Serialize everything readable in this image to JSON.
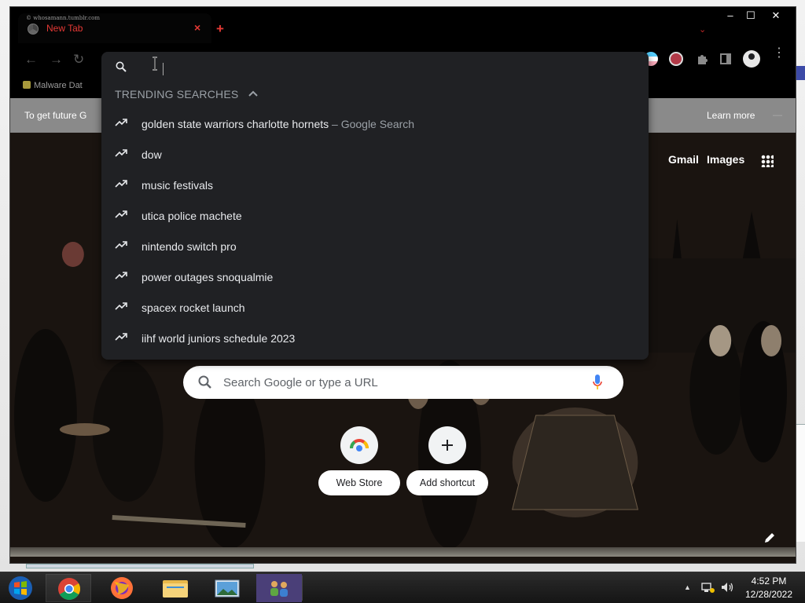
{
  "window": {
    "tab_title": "New Tab",
    "tab_watermark": "© whosamann.tumblr.com",
    "new_tab_symbol": "+",
    "tab_close_symbol": "×",
    "controls": {
      "minimize": "–",
      "maximize": "☐",
      "close": "✕"
    }
  },
  "toolbar": {
    "back_icon": "←",
    "forward_icon": "→",
    "reload_icon": "↻",
    "extensions": [
      "flag-icon",
      "avatar-extension-icon",
      "puzzle-icon",
      "sidepanel-icon"
    ],
    "menu_icon": "⋮"
  },
  "bookmarks": [
    {
      "label": "Malware Dat"
    }
  ],
  "infobar": {
    "message": "To get future G",
    "learn_more": "Learn more"
  },
  "omnibox": {
    "input_value": "",
    "section_title": "TRENDING SEARCHES",
    "suggestions": [
      {
        "query": "golden state warriors charlotte hornets",
        "suffix": " – Google Search"
      },
      {
        "query": "dow",
        "suffix": ""
      },
      {
        "query": "music festivals",
        "suffix": ""
      },
      {
        "query": "utica police machete",
        "suffix": ""
      },
      {
        "query": "nintendo switch pro",
        "suffix": ""
      },
      {
        "query": "power outages snoqualmie",
        "suffix": ""
      },
      {
        "query": "spacex rocket launch",
        "suffix": ""
      },
      {
        "query": "iihf world juniors schedule 2023",
        "suffix": ""
      }
    ]
  },
  "ntp": {
    "gmail": "Gmail",
    "images": "Images",
    "search_placeholder": "Search Google or type a URL",
    "shortcuts": [
      {
        "label": "Web Store"
      },
      {
        "label": "Add shortcut"
      }
    ]
  },
  "taskbar": {
    "apps": [
      "windows-start-icon",
      "chrome-icon",
      "firefox-icon",
      "file-explorer-icon",
      "photo-viewer-icon",
      "network-people-icon"
    ],
    "tray_chevron": "▲",
    "time": "4:52 PM",
    "date": "12/28/2022"
  },
  "colors": {
    "dropdown_bg": "#202124",
    "tab_text": "#e53935",
    "infobar_bg": "#8a8a8a"
  }
}
